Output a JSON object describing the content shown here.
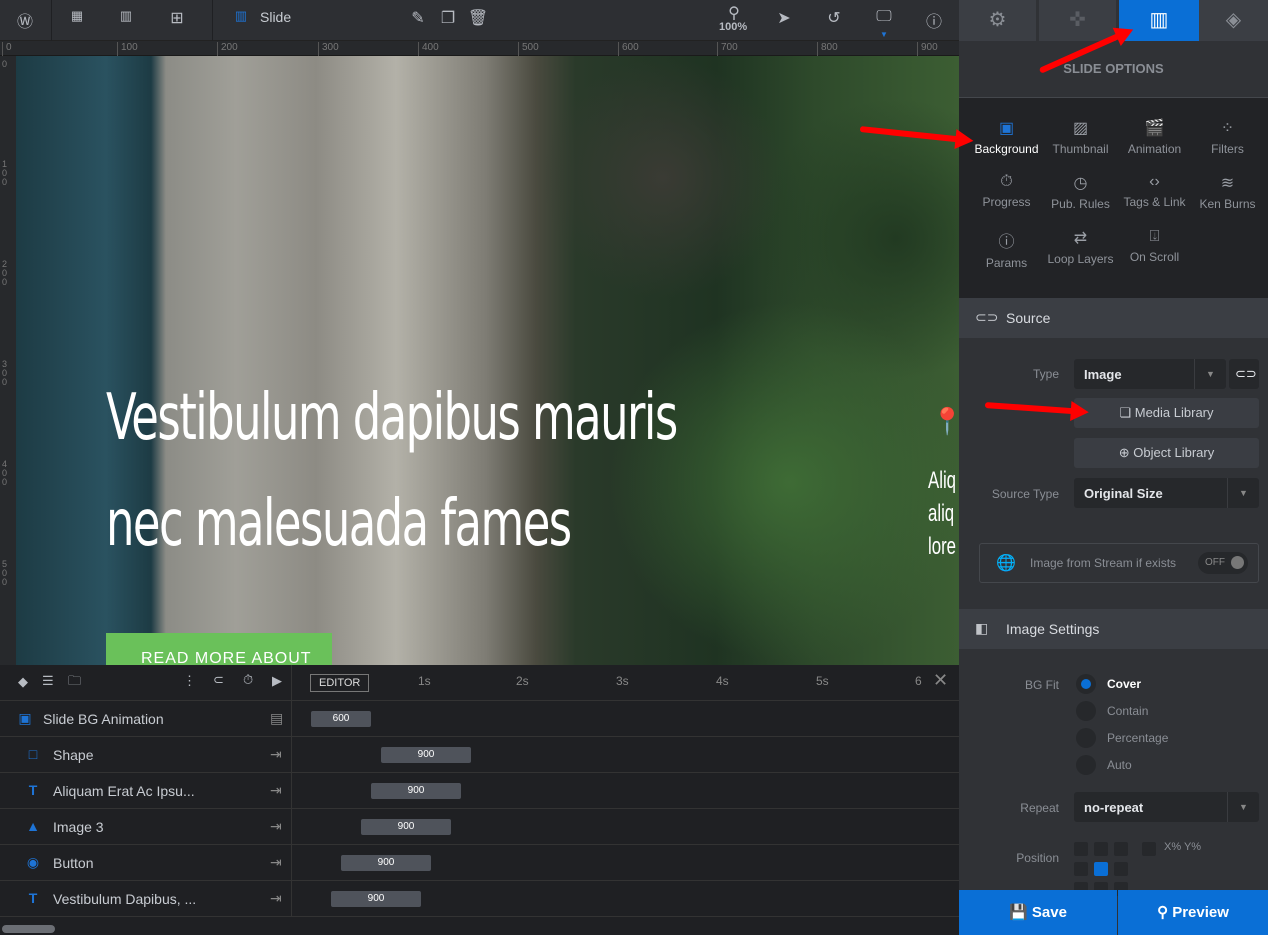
{
  "toolbar": {
    "slide_label": "Slide",
    "zoom": "100%"
  },
  "ruler": {
    "h_ticks": [
      "0",
      "100",
      "200",
      "300",
      "400",
      "500",
      "600",
      "700",
      "800",
      "900"
    ],
    "v_ticks": [
      "0",
      "100",
      "200",
      "300",
      "400",
      "500"
    ]
  },
  "canvas": {
    "headline_line1": "Vestibulum dapibus mauris",
    "headline_line2": "nec malesuada fames",
    "button": "READ MORE ABOUT US",
    "side_lines": [
      "Aliq",
      "aliq",
      "lore"
    ]
  },
  "timeline": {
    "editor_label": "EDITOR",
    "time_ticks": [
      "1s",
      "2s",
      "3s",
      "4s",
      "5s",
      "6"
    ],
    "rows": [
      {
        "name": "Slide BG Animation",
        "icon": "image-icon",
        "duration": "600"
      },
      {
        "name": "Shape",
        "icon": "square-icon",
        "duration": "900"
      },
      {
        "name": "Aliquam Erat Ac Ipsu...",
        "icon": "text-icon",
        "duration": "900"
      },
      {
        "name": "Image 3",
        "icon": "mountain-icon",
        "duration": "900"
      },
      {
        "name": "Button",
        "icon": "button-icon",
        "duration": "900"
      },
      {
        "name": "Vestibulum Dapibus, ...",
        "icon": "text-icon",
        "duration": "900"
      }
    ]
  },
  "panel": {
    "title": "SLIDE OPTIONS",
    "options": [
      "Background",
      "Thumbnail",
      "Animation",
      "Filters",
      "Progress",
      "Pub. Rules",
      "Tags & Link",
      "Ken Burns",
      "Params",
      "Loop Layers",
      "On Scroll"
    ],
    "source": {
      "header": "Source",
      "type_label": "Type",
      "type_value": "Image",
      "media_library": "Media Library",
      "object_library": "Object Library",
      "source_type_label": "Source Type",
      "source_type_value": "Original Size",
      "stream_label": "Image from Stream if exists",
      "stream_toggle": "OFF"
    },
    "image_settings": {
      "header": "Image Settings",
      "bg_fit_label": "BG Fit",
      "bg_fit_options": [
        "Cover",
        "Contain",
        "Percentage",
        "Auto"
      ],
      "bg_fit_selected": "Cover",
      "repeat_label": "Repeat",
      "repeat_value": "no-repeat",
      "position_label": "Position",
      "position_xy": "X% Y%"
    },
    "save": "Save",
    "preview": "Preview"
  },
  "colors": {
    "accent": "#0a6fd6",
    "green": "#6ac15a",
    "annotation": "#ff0000"
  }
}
